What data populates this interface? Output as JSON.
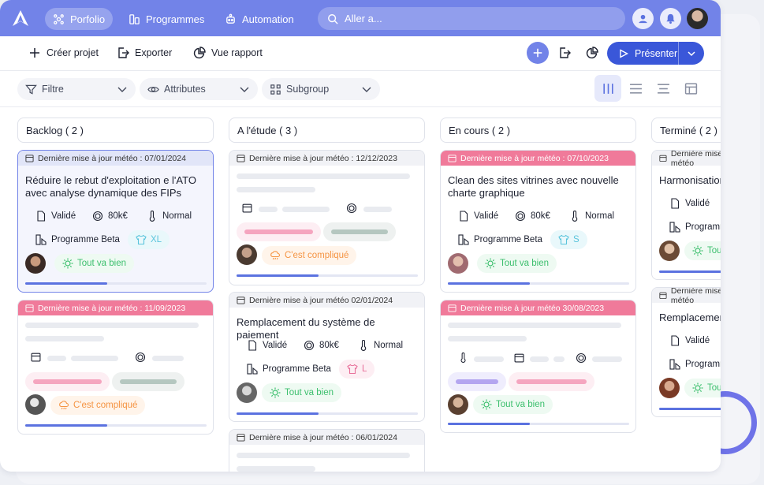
{
  "nav": {
    "porfolio": "Porfolio",
    "programmes": "Programmes",
    "automation": "Automation",
    "search_placeholder": "Aller a..."
  },
  "toolbar": {
    "create": "Créer projet",
    "export": "Exporter",
    "report": "Vue rapport",
    "present": "Présenter"
  },
  "filters": {
    "filter": "Filtre",
    "attributes": "Attributes",
    "subgroup": "Subgroup"
  },
  "columns": [
    {
      "title": "Backlog ( 2 )"
    },
    {
      "title": "A l'étude ( 3 )"
    },
    {
      "title": "En cours ( 2 )"
    },
    {
      "title": "Terminé ( 2 )"
    }
  ],
  "cards": {
    "b1": {
      "meteo": "Dernière mise à jour météo : 07/01/2024",
      "title": "Réduire le rebut d'exploitation e l'ATO avec analyse dynamique des FIPs",
      "status": "Validé",
      "budget": "80k€",
      "priority": "Normal",
      "programme": "Programme Beta",
      "size": "XL",
      "weather": "Tout va bien",
      "progress": 0.45
    },
    "b2": {
      "meteo": "Dernière mise à jour météo : 11/09/2023",
      "weather": "C'est compliqué",
      "progress": 0.45
    },
    "e1": {
      "meteo": "Dernière mise à jour météo : 12/12/2023",
      "weather": "C'est compliqué",
      "progress": 0.45
    },
    "e2": {
      "meteo": "Dernière mise à jour météo 02/01/2024",
      "title": "Remplacement du système de paiement",
      "status": "Validé",
      "budget": "80k€",
      "priority": "Normal",
      "programme": "Programme Beta",
      "size": "L",
      "weather": "Tout va bien",
      "progress": 0.45
    },
    "e3": {
      "meteo": "Dernière mise à jour météo : 06/01/2024"
    },
    "c1": {
      "meteo": "Dernière mise à jour météo : 07/10/2023",
      "title": "Clean des sites vitrines avec nouvelle charte graphique",
      "status": "Validé",
      "budget": "80k€",
      "priority": "Normal",
      "programme": "Programme Beta",
      "size": "S",
      "weather": "Tout va bien",
      "progress": 0.45
    },
    "c2": {
      "meteo": "Dernière mise à jour météo 30/08/2023",
      "weather": "Tout va bien",
      "progress": 0.45
    },
    "t1": {
      "meteo": "Dernière mise à jour météo",
      "title": "Harmonisation",
      "status": "Validé",
      "programme": "Programme",
      "weather": "Tout va bien"
    },
    "t2": {
      "meteo": "Dernière mise à jour météo",
      "title": "Remplacement",
      "status": "Validé",
      "programme": "Programme",
      "weather": "Tout va bien"
    }
  },
  "colors": {
    "accent": "#7283e8",
    "primary": "#3a57d9",
    "alert": "#f07a9a",
    "success": "#3cbf6d",
    "warning": "#f59443"
  }
}
